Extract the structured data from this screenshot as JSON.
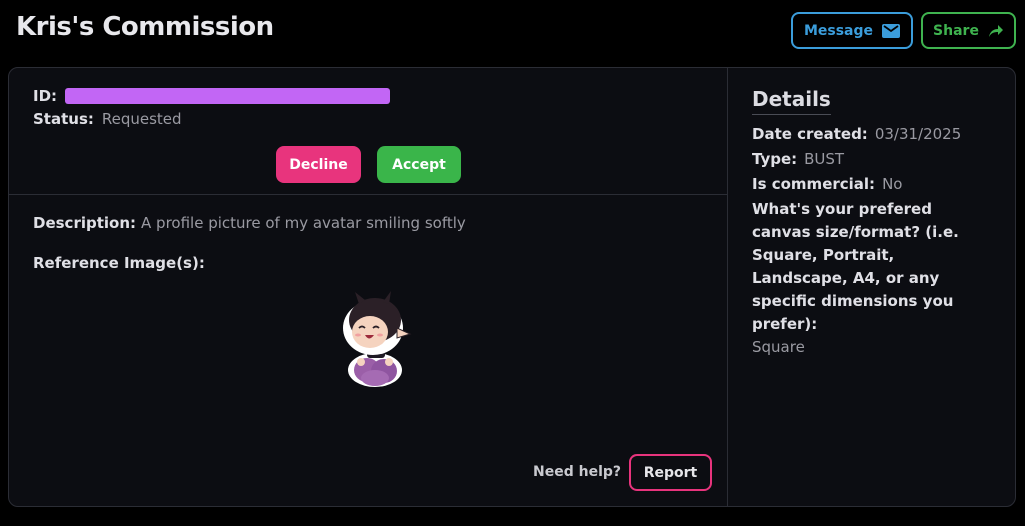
{
  "header": {
    "title": "Kris's Commission",
    "message_label": "Message",
    "share_label": "Share"
  },
  "request": {
    "id_label": "ID:",
    "status_label": "Status:",
    "status_value": "Requested",
    "decline_label": "Decline",
    "accept_label": "Accept",
    "description_label": "Description:",
    "description_value": "A profile picture of my avatar smiling softly",
    "reference_label": "Reference Image(s):",
    "help_text": "Need help?",
    "report_label": "Report"
  },
  "details": {
    "title": "Details",
    "date_label": "Date created:",
    "date_value": "03/31/2025",
    "type_label": "Type:",
    "type_value": "BUST",
    "commercial_label": "Is commercial:",
    "commercial_value": "No",
    "question": "What's your prefered canvas size/format? (i.e. Square, Portrait, Landscape, A4, or any specific dimensions you prefer):",
    "answer": "Square"
  },
  "colors": {
    "message": "#3b9ddb",
    "share": "#3fb34f",
    "decline": "#e8347d",
    "accept": "#3ab54a",
    "redaction": "#c266f5"
  },
  "icons": {
    "message": "envelope-icon",
    "share": "share-arrow-icon"
  }
}
